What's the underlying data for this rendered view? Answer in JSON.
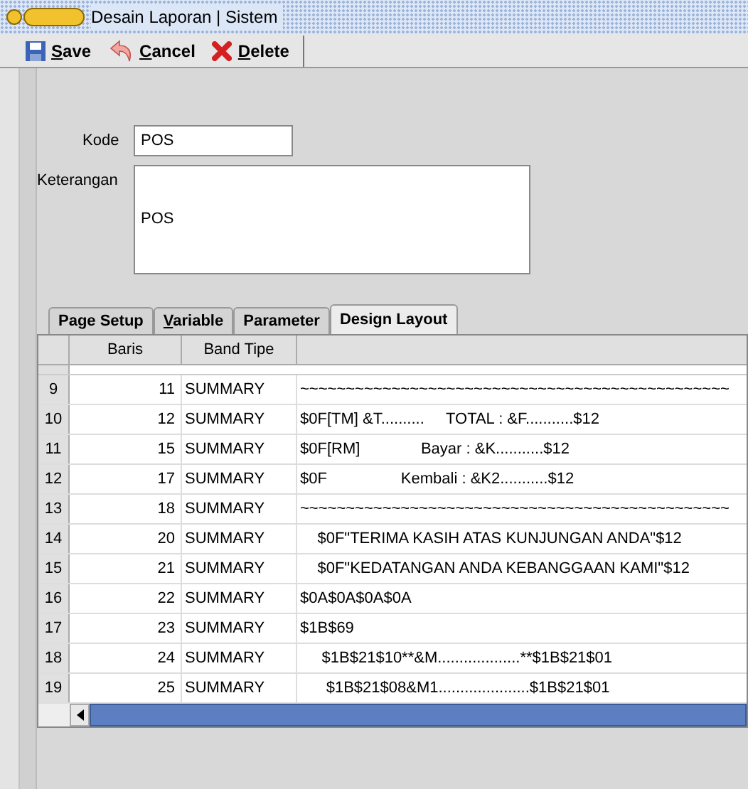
{
  "window": {
    "title": "Desain Laporan | Sistem"
  },
  "toolbar": [
    {
      "kind": "save",
      "label": "Save",
      "underline_first": true
    },
    {
      "kind": "cancel",
      "label": "Cancel",
      "underline_first": true
    },
    {
      "kind": "delete",
      "label": "Delete",
      "underline_first": true
    }
  ],
  "form": {
    "kode_label": "Kode",
    "kode_value": "POS",
    "keterangan_label": "Keterangan",
    "keterangan_value": "POS"
  },
  "tabs": [
    {
      "label": "Page Setup",
      "selected": false,
      "underline_first": false
    },
    {
      "label": "Variable",
      "selected": false,
      "underline_first": true
    },
    {
      "label": "Parameter",
      "selected": false,
      "underline_first": false
    },
    {
      "label": "Design Layout",
      "selected": true,
      "underline_first": false
    }
  ],
  "table": {
    "columns": [
      "Baris",
      "Band Tipe"
    ],
    "rows": [
      {
        "no": "9",
        "baris": "11",
        "band": "SUMMARY",
        "text": "~~~~~~~~~~~~~~~~~~~~~~~~~~~~~~~~~~~~~~~~~~~~~~~"
      },
      {
        "no": "10",
        "baris": "12",
        "band": "SUMMARY",
        "text": "$0F[TM] &T..........     TOTAL : &F...........$12"
      },
      {
        "no": "11",
        "baris": "15",
        "band": "SUMMARY",
        "text": "$0F[RM]              Bayar : &K...........$12"
      },
      {
        "no": "12",
        "baris": "17",
        "band": "SUMMARY",
        "text": "$0F                 Kembali : &K2...........$12"
      },
      {
        "no": "13",
        "baris": "18",
        "band": "SUMMARY",
        "text": "~~~~~~~~~~~~~~~~~~~~~~~~~~~~~~~~~~~~~~~~~~~~~~~"
      },
      {
        "no": "14",
        "baris": "20",
        "band": "SUMMARY",
        "text": "    $0F\"TERIMA KASIH ATAS KUNJUNGAN ANDA\"$12"
      },
      {
        "no": "15",
        "baris": "21",
        "band": "SUMMARY",
        "text": "    $0F\"KEDATANGAN ANDA KEBANGGAAN KAMI\"$12"
      },
      {
        "no": "16",
        "baris": "22",
        "band": "SUMMARY",
        "text": "$0A$0A$0A$0A"
      },
      {
        "no": "17",
        "baris": "23",
        "band": "SUMMARY",
        "text": "$1B$69"
      },
      {
        "no": "18",
        "baris": "24",
        "band": "SUMMARY",
        "text": "     $1B$21$10**&M...................**$1B$21$01"
      },
      {
        "no": "19",
        "baris": "25",
        "band": "SUMMARY",
        "text": "      $1B$21$08&M1.....................$1B$21$01"
      }
    ]
  }
}
